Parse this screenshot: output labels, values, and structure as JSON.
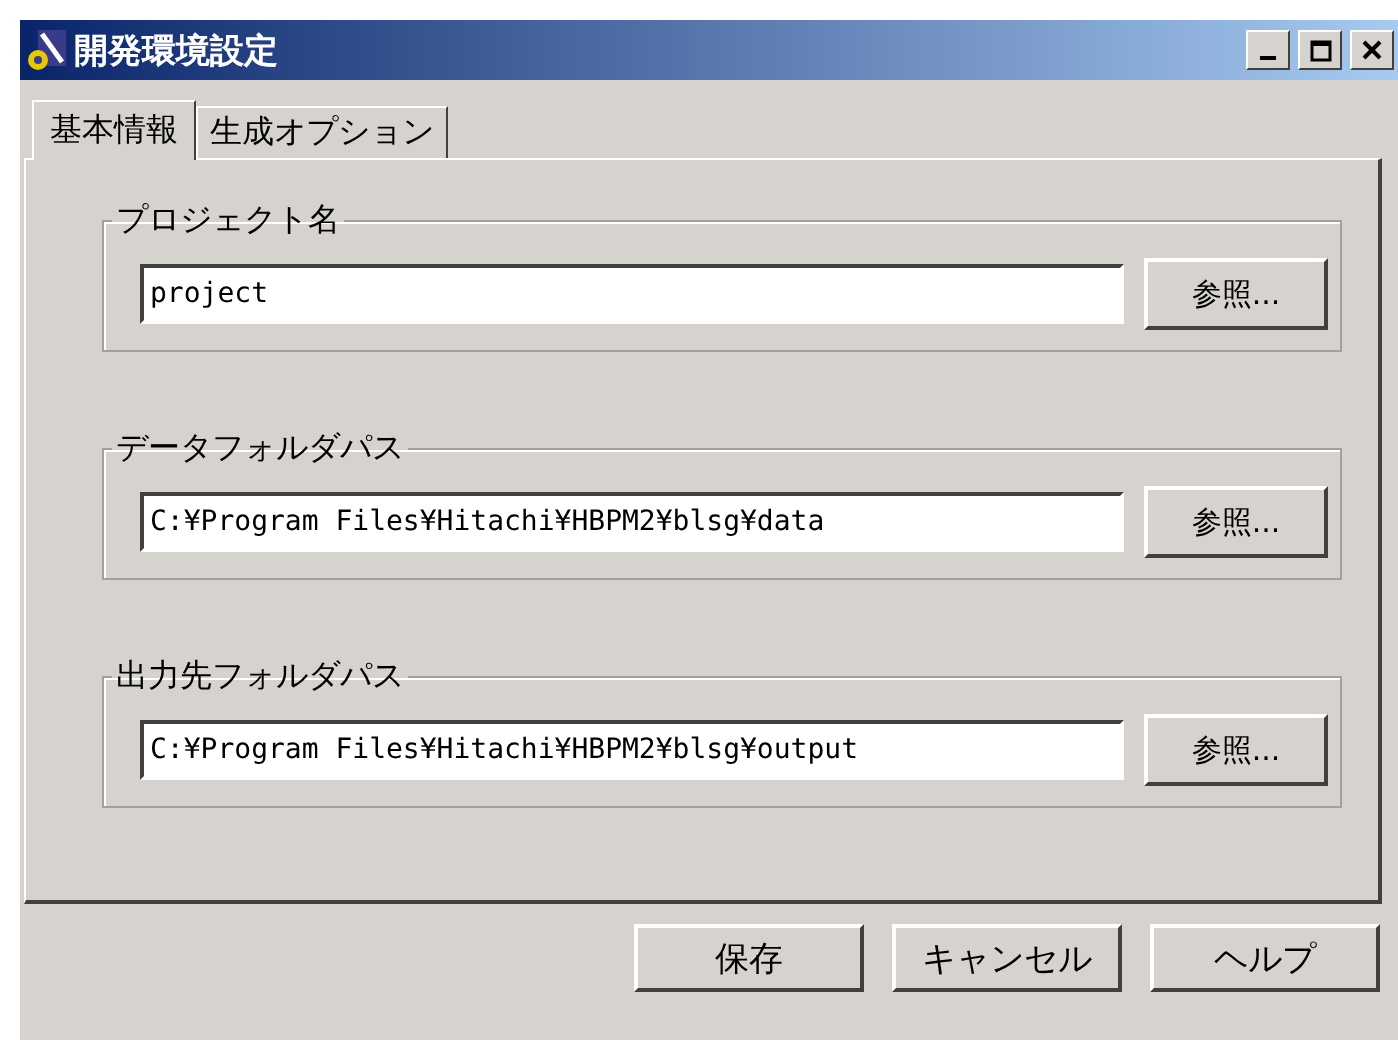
{
  "window": {
    "title": "開発環境設定",
    "controls": [
      {
        "kind": "minimize"
      },
      {
        "kind": "maximize"
      },
      {
        "kind": "close"
      }
    ]
  },
  "tabs": [
    {
      "label": "基本情報",
      "selected": true
    },
    {
      "label": "生成オプション",
      "selected": false
    }
  ],
  "groups": [
    {
      "title": "プロジェクト名",
      "value": "project",
      "button": "参照..."
    },
    {
      "title": "データフォルダパス",
      "value": "C:¥Program Files¥Hitachi¥HBPM2¥blsg¥data",
      "button": "参照..."
    },
    {
      "title": "出力先フォルダパス",
      "value": "C:¥Program Files¥Hitachi¥HBPM2¥blsg¥output",
      "button": "参照..."
    }
  ],
  "buttons": [
    "保存",
    "キャンセル",
    "ヘルプ"
  ]
}
